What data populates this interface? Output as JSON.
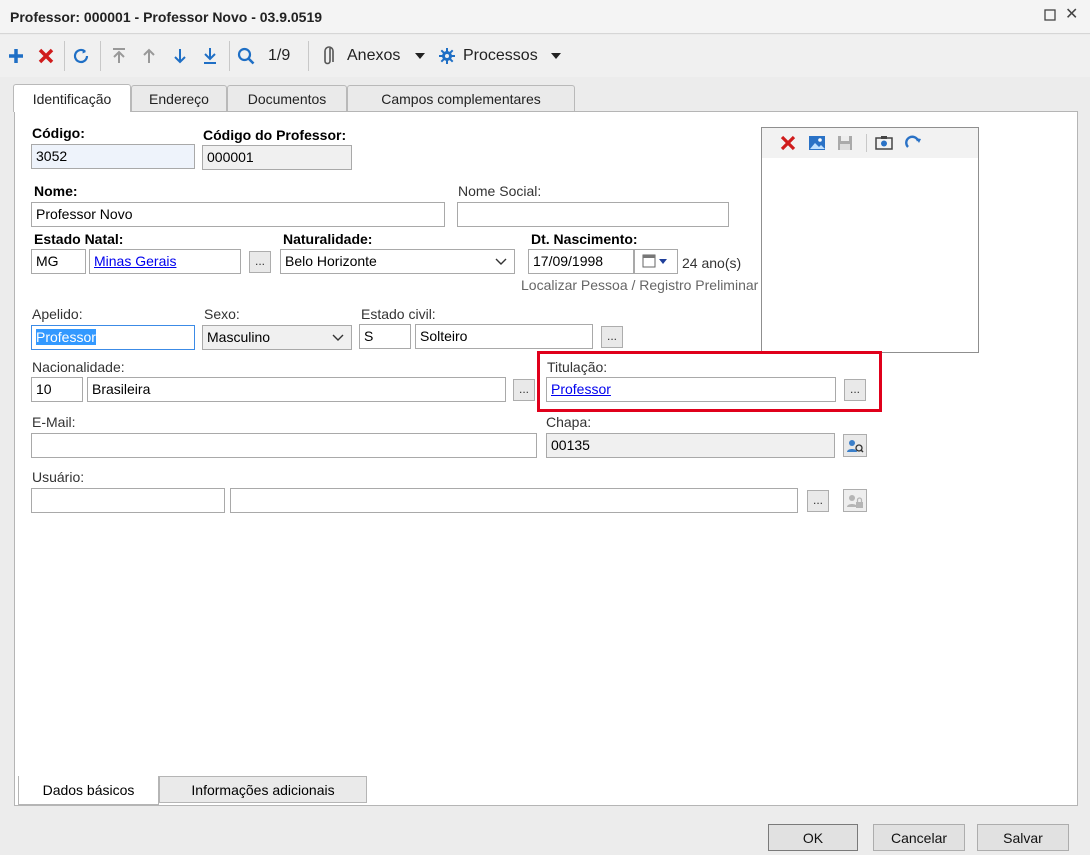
{
  "window": {
    "title": "Professor: 000001 - Professor Novo - 03.9.0519"
  },
  "toolbar": {
    "record_position": "1/9",
    "attachments_label": "Anexos",
    "processes_label": "Processos"
  },
  "tabs": [
    {
      "label": "Identificação",
      "active": true
    },
    {
      "label": "Endereço",
      "active": false
    },
    {
      "label": "Documentos",
      "active": false
    },
    {
      "label": "Campos complementares",
      "active": false
    }
  ],
  "form": {
    "codigo": {
      "label": "Código:",
      "value": "3052"
    },
    "codigo_professor": {
      "label": "Código do Professor:",
      "value": "000001"
    },
    "nome": {
      "label": "Nome:",
      "value": "Professor Novo"
    },
    "nome_social": {
      "label": "Nome Social:",
      "value": ""
    },
    "estado_natal": {
      "label": "Estado Natal:",
      "code": "MG",
      "name": "Minas Gerais"
    },
    "naturalidade": {
      "label": "Naturalidade:",
      "value": "Belo Horizonte"
    },
    "dt_nascimento": {
      "label": "Dt. Nascimento:",
      "value": "17/09/1998",
      "age": "24 ano(s)"
    },
    "localizar_pessoa": "Localizar Pessoa / Registro Preliminar",
    "apelido": {
      "label": "Apelido:",
      "value": "Professor"
    },
    "sexo": {
      "label": "Sexo:",
      "value": "Masculino"
    },
    "estado_civil": {
      "label": "Estado civil:",
      "code": "S",
      "name": "Solteiro"
    },
    "nacionalidade": {
      "label": "Nacionalidade:",
      "code": "10",
      "name": "Brasileira"
    },
    "titulacao": {
      "label": "Titulação:",
      "value": "Professor"
    },
    "email": {
      "label": "E-Mail:",
      "value": ""
    },
    "chapa": {
      "label": "Chapa:",
      "value": "00135"
    },
    "usuario": {
      "label": "Usuário:",
      "code": "",
      "name": ""
    },
    "ellipsis": "..."
  },
  "bottom_tabs": [
    {
      "label": "Dados básicos",
      "active": true
    },
    {
      "label": "Informações adicionais",
      "active": false
    }
  ],
  "buttons": {
    "ok": "OK",
    "cancel": "Cancelar",
    "save": "Salvar"
  },
  "colors": {
    "highlight": "#e0001b",
    "link": "#0000ee",
    "selection": "#3399ff",
    "add_icon": "#1f6fc5",
    "delete_icon": "#d01c1c"
  }
}
